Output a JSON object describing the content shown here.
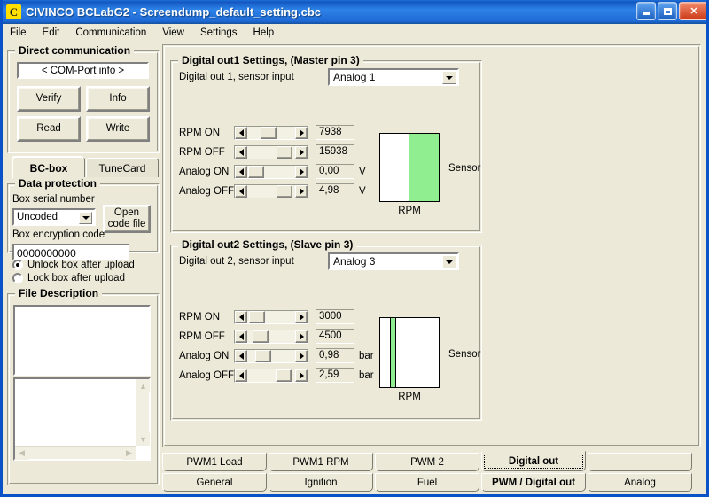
{
  "window": {
    "title": "CIVINCO  BCLabG2 - Screendump_default_setting.cbc",
    "app_icon": "C",
    "buttons": {
      "minimize": "minimize-icon",
      "maximize": "maximize-icon",
      "close": "✕"
    }
  },
  "menubar": {
    "items": [
      "File",
      "Edit",
      "Communication",
      "View",
      "Settings",
      "Help"
    ]
  },
  "left": {
    "direct_communication": {
      "title": "Direct communication",
      "comport": "< COM-Port info >",
      "verify": "Verify",
      "info": "Info",
      "read": "Read",
      "write": "Write"
    },
    "box_tabs": [
      {
        "label": "BC-box",
        "active": true
      },
      {
        "label": "TuneCard",
        "active": false
      }
    ],
    "data_protection": {
      "title": "Data protection",
      "serial_label": "Box serial number",
      "serial_value": "Uncoded",
      "open_code_file": "Open code file",
      "encryption_label": "Box encryption code",
      "encryption_value": "0000000000",
      "radio_unlock": "Unlock box after upload",
      "radio_lock": "Lock box after upload",
      "selected": "unlock"
    },
    "file_description": {
      "title": "File Description",
      "text1": "",
      "text2": ""
    }
  },
  "main": {
    "out1": {
      "title": "Digital out1 Settings, (Master pin 3)",
      "input_label": "Digital out 1, sensor input",
      "input_value": "Analog 1",
      "rows": [
        {
          "name": "RPM ON",
          "value": "7938",
          "unit": "",
          "thumb_pct": 42
        },
        {
          "name": "RPM OFF",
          "value": "15938",
          "unit": "",
          "thumb_pct": 92
        },
        {
          "name": "Analog ON",
          "value": "0,00",
          "unit": "V",
          "thumb_pct": 2
        },
        {
          "name": "Analog OFF",
          "value": "4,98",
          "unit": "V",
          "thumb_pct": 92
        }
      ],
      "graphic": {
        "rpm_label": "RPM",
        "sensor_label": "Sensor",
        "green_color": "#90EE90",
        "green_left_pct": 50,
        "green_width_pct": 50,
        "divider_pct": null
      }
    },
    "out2": {
      "title": "Digital out2 Settings, (Slave pin 3)",
      "input_label": "Digital out 2, sensor input",
      "input_value": "Analog 3",
      "rows": [
        {
          "name": "RPM ON",
          "value": "3000",
          "unit": "",
          "thumb_pct": 6
        },
        {
          "name": "RPM OFF",
          "value": "4500",
          "unit": "",
          "thumb_pct": 17
        },
        {
          "name": "Analog ON",
          "value": "0,98",
          "unit": "bar",
          "thumb_pct": 26
        },
        {
          "name": "Analog OFF",
          "value": "2,59",
          "unit": "bar",
          "thumb_pct": 90
        }
      ],
      "graphic": {
        "rpm_label": "RPM",
        "sensor_label": "Sensor",
        "green_color": "#90EE90",
        "green_left_pct": 16,
        "green_width_pct": 10,
        "divider_pct": 62
      }
    }
  },
  "tabs": {
    "row1": [
      {
        "label": "PWM1 Load",
        "state": "normal"
      },
      {
        "label": "PWM1 RPM",
        "state": "normal"
      },
      {
        "label": "PWM 2",
        "state": "normal"
      },
      {
        "label": "Digital out",
        "state": "focused"
      },
      {
        "label": "",
        "state": "blank"
      }
    ],
    "row2": [
      {
        "label": "General",
        "state": "normal"
      },
      {
        "label": "Ignition",
        "state": "normal"
      },
      {
        "label": "Fuel",
        "state": "normal"
      },
      {
        "label": "PWM / Digital out",
        "state": "selected"
      },
      {
        "label": "Analog",
        "state": "normal"
      }
    ]
  }
}
